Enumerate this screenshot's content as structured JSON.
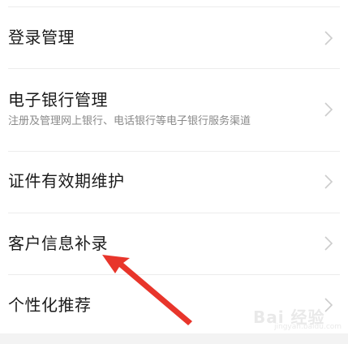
{
  "menu": {
    "items": [
      {
        "title": "登录管理",
        "subtitle": ""
      },
      {
        "title": "电子银行管理",
        "subtitle": "注册及管理网上银行、电话银行等电子银行服务渠道"
      },
      {
        "title": "证件有效期维护",
        "subtitle": ""
      },
      {
        "title": "客户信息补录",
        "subtitle": ""
      },
      {
        "title": "个性化推荐",
        "subtitle": ""
      }
    ]
  },
  "icons": {
    "row_chevron": "chevron-right-icon",
    "annotation": "red-arrow-icon"
  },
  "colors": {
    "background": "#ffffff",
    "title_text": "#1a1a1a",
    "subtitle_text": "#8a8a8a",
    "divider": "#ececec",
    "chevron": "#cccccc",
    "annotation_arrow": "#e8352b",
    "bottom_bar": "#f3f3f3"
  },
  "watermark": {
    "text": "Bai 经验",
    "url": "jingyan.baidu.com"
  }
}
